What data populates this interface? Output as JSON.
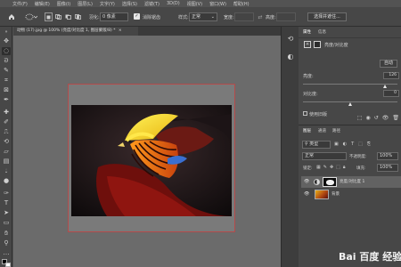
{
  "menubar": {
    "items": [
      "文件(F)",
      "编辑(E)",
      "图像(I)",
      "图层(L)",
      "文字(Y)",
      "选择(S)",
      "滤镜(T)",
      "3D(D)",
      "视图(V)",
      "窗口(W)",
      "帮助(H)"
    ]
  },
  "options": {
    "feather_label": "羽化:",
    "feather_value": "0 像素",
    "antialias_label": "消除锯齿",
    "style_label": "样式:",
    "style_value": "正常",
    "width_label": "宽度:",
    "height_label": "高度:",
    "select_mask_label": "选择并遮住..."
  },
  "document": {
    "tab_label": "动物 (17).jpg @ 100% (亮度/对比度 1, 图层蒙版/8) *",
    "close_glyph": "×"
  },
  "properties": {
    "tab_properties": "属性",
    "tab_info": "信息",
    "adjustment_title": "亮度/对比度",
    "auto_label": "自动",
    "brightness_label": "亮度:",
    "brightness_value": "126",
    "contrast_label": "对比度:",
    "contrast_value": "0",
    "legacy_label": "使用旧版",
    "brightness_fraction": 0.87,
    "contrast_fraction": 0.5
  },
  "layers": {
    "tab_layers": "图层",
    "tab_channels": "通道",
    "tab_paths": "路径",
    "filter_kind": "类型",
    "blend_mode": "正常",
    "opacity_label": "不透明度:",
    "opacity_value": "100%",
    "lock_label": "锁定:",
    "fill_label": "填充:",
    "fill_value": "100%",
    "items": [
      {
        "name": "亮度/对比度 1"
      },
      {
        "name": "背景"
      }
    ]
  },
  "watermark": {
    "text": "Bai 百度 经验"
  },
  "colors": {
    "accent": "#3b73c7",
    "photo_yellow": "#f7d21a",
    "photo_red": "#8a1410"
  }
}
